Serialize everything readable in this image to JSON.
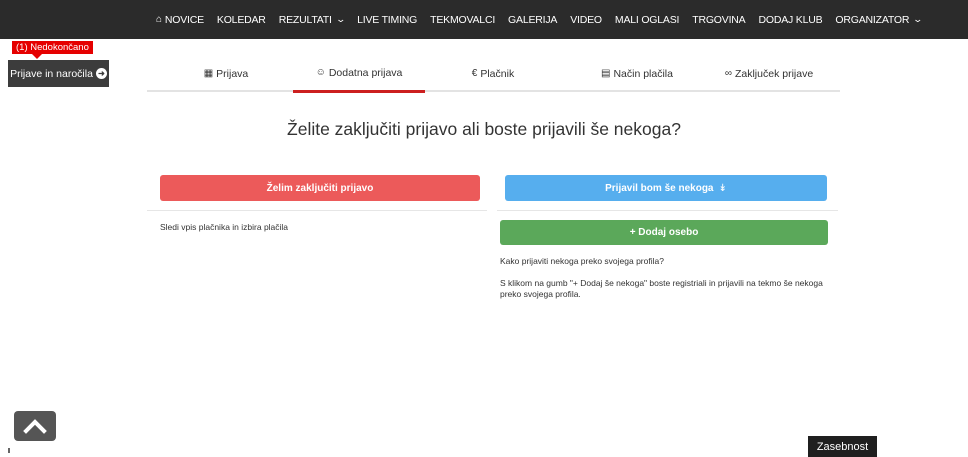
{
  "nav": {
    "items": [
      {
        "label": "NOVICE",
        "icon": "home-icon"
      },
      {
        "label": "KOLEDAR"
      },
      {
        "label": "REZULTATI",
        "dropdown": true
      },
      {
        "label": "LIVE TIMING"
      },
      {
        "label": "TEKMOVALCI"
      },
      {
        "label": "GALERIJA"
      },
      {
        "label": "VIDEO"
      },
      {
        "label": "MALI OGLASI"
      },
      {
        "label": "TRGOVINA"
      },
      {
        "label": "DODAJ KLUB"
      },
      {
        "label": "ORGANIZATOR",
        "dropdown": true
      }
    ]
  },
  "sidewidget": {
    "badge": "(1) Nedokončano",
    "button": "Prijave in naročila"
  },
  "steps": [
    {
      "label": "Prijava",
      "icon": "calendar-icon"
    },
    {
      "label": "Dodatna prijava",
      "icon": "users-icon",
      "active": true
    },
    {
      "label": "Plačnik",
      "icon": "euro-icon"
    },
    {
      "label": "Način plačila",
      "icon": "credit-card-icon"
    },
    {
      "label": "Zaključek prijave",
      "icon": "bicycle-icon"
    }
  ],
  "question": "Želite zaključiti prijavo ali boste prijavili še nekoga?",
  "left": {
    "button": "Želim zaključiti prijavo",
    "note": "Sledi vpis plačnika in izbira plačila"
  },
  "right": {
    "button": "Prijavil bom še nekoga",
    "add_button": "+ Dodaj osebo",
    "question": "Kako prijaviti nekoga preko svojega profila?",
    "explanation": "S klikom na gumb \"+ Dodaj še nekoga\" boste registriali in prijavili na tekmo še nekoga preko svojega profila."
  },
  "privacy": "Zasebnost",
  "colors": {
    "nav_bg": "#2b2b2b",
    "finish": "#ec5a5a",
    "more": "#56aeee",
    "add": "#5ba85a",
    "active_step": "#cc1f1f",
    "badge": "#e50000"
  }
}
